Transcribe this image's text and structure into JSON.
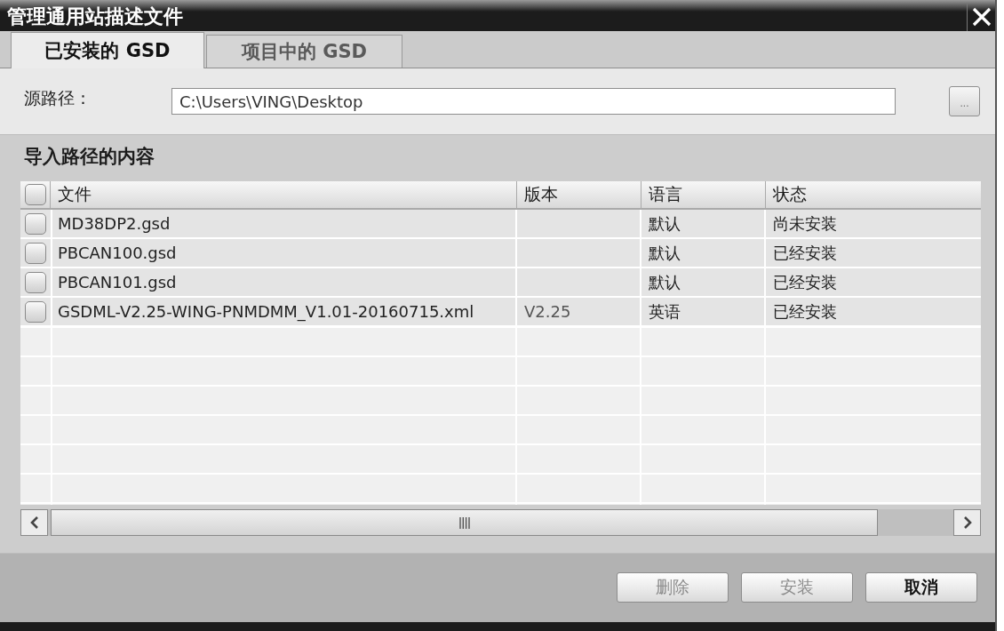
{
  "window": {
    "title": "管理通用站描述文件"
  },
  "tabs": [
    {
      "label": "已安装的 GSD",
      "selected": true
    },
    {
      "label": "项目中的 GSD",
      "selected": false
    }
  ],
  "source_path": {
    "label": "源路径：",
    "value": "C:\\Users\\VING\\Desktop",
    "browse_button": "..."
  },
  "content": {
    "title": "导入路径的内容",
    "table": {
      "header_checked": false,
      "columns": [
        "文件",
        "版本",
        "语言",
        "状态"
      ],
      "rows": [
        {
          "checked": false,
          "file": "MD38DP2.gsd",
          "language": "默认",
          "status": "尚未安装"
        },
        {
          "checked": false,
          "file": "PBCAN100.gsd",
          "language": "默认",
          "status": "已经安装"
        },
        {
          "checked": false,
          "file": "PBCAN101.gsd",
          "language": "默认",
          "status": "已经安装"
        },
        {
          "checked": false,
          "file": "GSDML-V2.25-WING-PNMDMM_V1.01-20160715.xml",
          "version": "V2.25",
          "language": "英语",
          "status": "已经安装"
        }
      ]
    }
  },
  "buttons": [
    {
      "label": "删除",
      "disabled": true
    },
    {
      "label": "安装",
      "disabled": true
    },
    {
      "label": "取消",
      "disabled": false
    }
  ]
}
